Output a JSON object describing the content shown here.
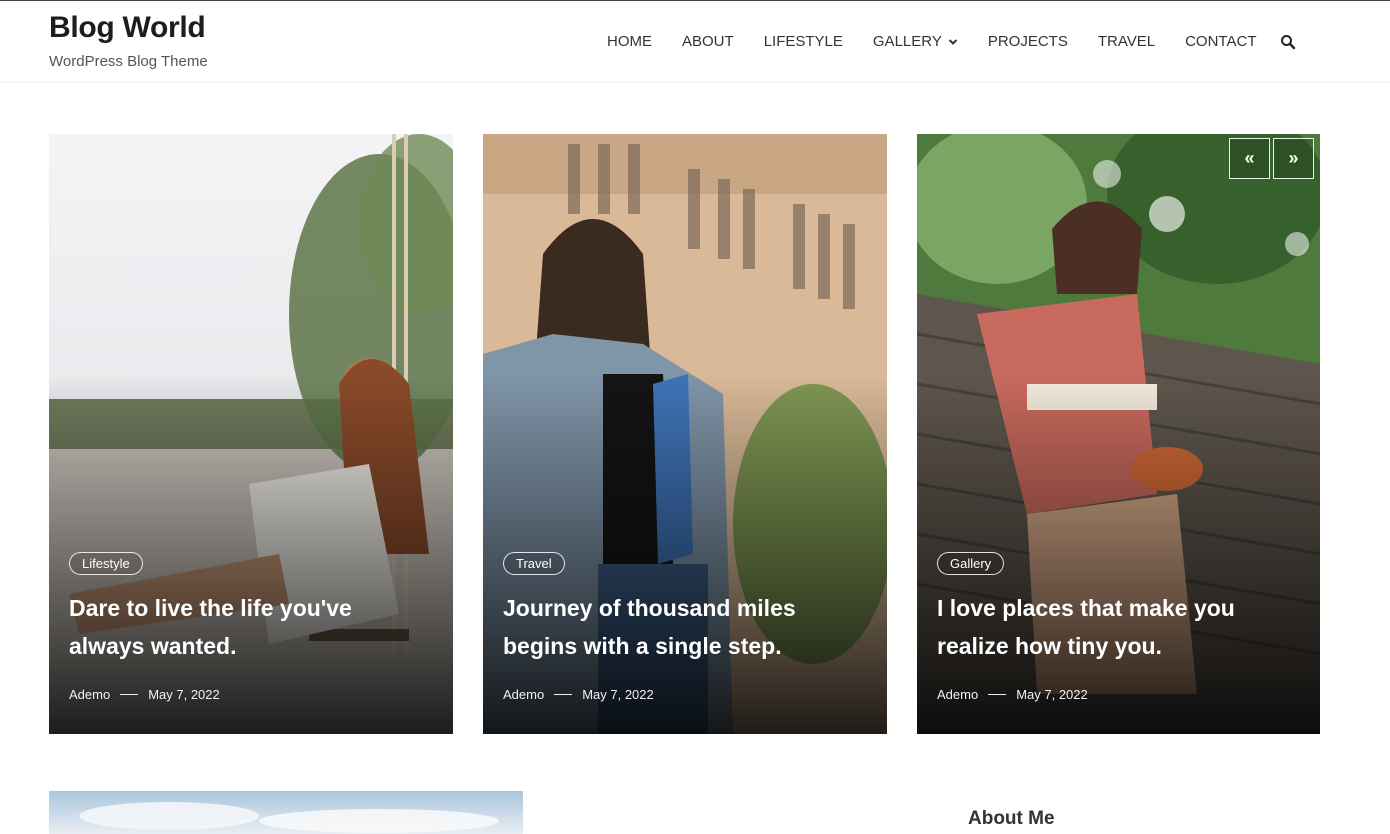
{
  "site": {
    "title": "Blog World",
    "tagline": "WordPress Blog Theme"
  },
  "nav": {
    "items": [
      {
        "label": "HOME"
      },
      {
        "label": "ABOUT"
      },
      {
        "label": "LIFESTYLE"
      },
      {
        "label": "GALLERY",
        "has_dropdown": true
      },
      {
        "label": "PROJECTS"
      },
      {
        "label": "TRAVEL"
      },
      {
        "label": "CONTACT"
      }
    ],
    "search_icon": "search-icon"
  },
  "slider": {
    "prev_label": "«",
    "next_label": "»",
    "posts": [
      {
        "category": "Lifestyle",
        "title": "Dare to live the life you've always wanted.",
        "author": "Ademo",
        "date": "May 7, 2022"
      },
      {
        "category": "Travel",
        "title": "Journey of thousand miles begins with a single step.",
        "author": "Ademo",
        "date": "May 7, 2022"
      },
      {
        "category": "Gallery",
        "title": "I love places that make you realize how tiny you.",
        "author": "Ademo",
        "date": "May 7, 2022"
      }
    ]
  },
  "sidebar": {
    "about_heading": "About Me"
  },
  "colors": {
    "text_dark": "#1d1d1d",
    "nav_text": "#333333",
    "overlay_text": "#ffffff"
  }
}
